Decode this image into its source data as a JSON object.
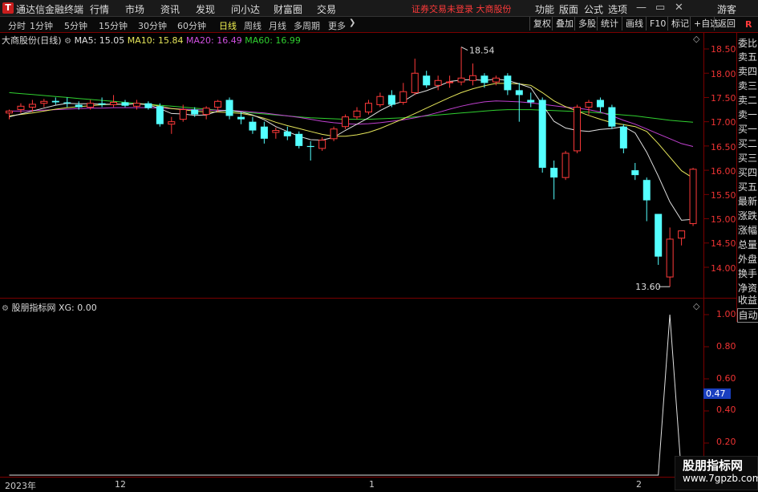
{
  "menubar": {
    "app_title": "通达信金融终端",
    "menus": [
      "行情",
      "市场",
      "资讯",
      "发现",
      "问小达",
      "财富圈",
      "交易"
    ],
    "notice": "证券交易未登录  大商股份",
    "tools": [
      "功能",
      "版面",
      "公式",
      "选项"
    ],
    "guest": "游客",
    "window_buttons": [
      "—",
      "▭",
      "✕"
    ]
  },
  "periods": {
    "items": [
      "分时",
      "1分钟",
      "5分钟",
      "15分钟",
      "30分钟",
      "60分钟",
      "日线",
      "周线",
      "月线",
      "多周期",
      "更多"
    ],
    "active": "日线"
  },
  "right_toolbar": [
    "复权",
    "叠加",
    "多股",
    "统计",
    "画线",
    "F10",
    "标记",
    "+自选",
    "返回"
  ],
  "main_info": {
    "stock": "大商股份(日线)",
    "ma5": "MA5: 15.05",
    "ma10": "MA10: 15.84",
    "ma20": "MA20: 16.49",
    "ma60": "MA60: 16.99"
  },
  "sub_info": {
    "name": "股朋指标网",
    "xg": "XG: 0.00"
  },
  "price_axis": [
    "18.50",
    "18.00",
    "17.50",
    "17.00",
    "16.50",
    "16.00",
    "15.50",
    "15.00",
    "14.50",
    "14.00"
  ],
  "sub_axis": [
    "1.00",
    "0.80",
    "0.60",
    "0.47",
    "0.40",
    "0.20"
  ],
  "sub_axis_current": "0.47",
  "annotations": {
    "high": "18.54",
    "low": "13.60"
  },
  "sidebar": {
    "items": [
      "委比",
      "卖五",
      "卖四",
      "卖三",
      "卖二",
      "卖一",
      "买一",
      "买二",
      "买三",
      "买四",
      "买五",
      "最新",
      "涨跌",
      "涨幅",
      "总量",
      "外盘",
      "换手",
      "净资",
      "收益"
    ],
    "auto": "自动",
    "top_mark": "R"
  },
  "date_axis": [
    "2023年",
    "12",
    "1",
    "2"
  ],
  "watermark": {
    "name": "股朋指标网",
    "url": "www.7gpzb.com"
  },
  "colors": {
    "up": "#ff3a3a",
    "down": "#54ffff",
    "ma5": "#e0e0e0",
    "ma10": "#e6e65a",
    "ma20": "#c040d0",
    "ma60": "#30d030",
    "frame": "#7a0000"
  },
  "chart_data": {
    "type": "candlestick",
    "ylim": [
      13.5,
      18.8
    ],
    "candles": [
      {
        "o": 17.18,
        "h": 17.25,
        "l": 17.05,
        "c": 17.22
      },
      {
        "o": 17.25,
        "h": 17.38,
        "l": 17.18,
        "c": 17.32
      },
      {
        "o": 17.3,
        "h": 17.45,
        "l": 17.2,
        "c": 17.36
      },
      {
        "o": 17.38,
        "h": 17.47,
        "l": 17.3,
        "c": 17.42
      },
      {
        "o": 17.43,
        "h": 17.5,
        "l": 17.35,
        "c": 17.4
      },
      {
        "o": 17.4,
        "h": 17.5,
        "l": 17.3,
        "c": 17.38
      },
      {
        "o": 17.35,
        "h": 17.42,
        "l": 17.25,
        "c": 17.3
      },
      {
        "o": 17.3,
        "h": 17.45,
        "l": 17.25,
        "c": 17.38
      },
      {
        "o": 17.38,
        "h": 17.5,
        "l": 17.3,
        "c": 17.35
      },
      {
        "o": 17.35,
        "h": 17.55,
        "l": 17.3,
        "c": 17.4
      },
      {
        "o": 17.4,
        "h": 17.45,
        "l": 17.3,
        "c": 17.33
      },
      {
        "o": 17.32,
        "h": 17.45,
        "l": 17.25,
        "c": 17.38
      },
      {
        "o": 17.38,
        "h": 17.42,
        "l": 17.25,
        "c": 17.28
      },
      {
        "o": 17.32,
        "h": 17.38,
        "l": 16.9,
        "c": 16.95
      },
      {
        "o": 16.95,
        "h": 17.1,
        "l": 16.75,
        "c": 17.0
      },
      {
        "o": 17.05,
        "h": 17.35,
        "l": 17.0,
        "c": 17.25
      },
      {
        "o": 17.25,
        "h": 17.3,
        "l": 17.1,
        "c": 17.15
      },
      {
        "o": 17.15,
        "h": 17.32,
        "l": 17.05,
        "c": 17.28
      },
      {
        "o": 17.3,
        "h": 17.45,
        "l": 17.2,
        "c": 17.42
      },
      {
        "o": 17.45,
        "h": 17.5,
        "l": 17.05,
        "c": 17.12
      },
      {
        "o": 17.1,
        "h": 17.2,
        "l": 16.95,
        "c": 17.05
      },
      {
        "o": 17.0,
        "h": 17.1,
        "l": 16.75,
        "c": 16.82
      },
      {
        "o": 16.9,
        "h": 17.0,
        "l": 16.55,
        "c": 16.65
      },
      {
        "o": 16.78,
        "h": 16.88,
        "l": 16.65,
        "c": 16.82
      },
      {
        "o": 16.8,
        "h": 16.9,
        "l": 16.62,
        "c": 16.7
      },
      {
        "o": 16.75,
        "h": 16.8,
        "l": 16.45,
        "c": 16.5
      },
      {
        "o": 16.5,
        "h": 16.6,
        "l": 16.2,
        "c": 16.48
      },
      {
        "o": 16.45,
        "h": 16.68,
        "l": 16.4,
        "c": 16.62
      },
      {
        "o": 16.65,
        "h": 16.9,
        "l": 16.6,
        "c": 16.85
      },
      {
        "o": 16.9,
        "h": 17.15,
        "l": 16.85,
        "c": 17.1
      },
      {
        "o": 17.1,
        "h": 17.3,
        "l": 17.05,
        "c": 17.22
      },
      {
        "o": 17.2,
        "h": 17.45,
        "l": 17.15,
        "c": 17.38
      },
      {
        "o": 17.35,
        "h": 17.6,
        "l": 17.3,
        "c": 17.52
      },
      {
        "o": 17.55,
        "h": 17.65,
        "l": 17.3,
        "c": 17.35
      },
      {
        "o": 17.4,
        "h": 17.8,
        "l": 17.35,
        "c": 17.62
      },
      {
        "o": 17.6,
        "h": 18.3,
        "l": 17.55,
        "c": 18.0
      },
      {
        "o": 17.95,
        "h": 18.05,
        "l": 17.7,
        "c": 17.75
      },
      {
        "o": 17.75,
        "h": 17.95,
        "l": 17.65,
        "c": 17.85
      },
      {
        "o": 17.82,
        "h": 17.95,
        "l": 17.7,
        "c": 17.82
      },
      {
        "o": 17.82,
        "h": 18.54,
        "l": 17.75,
        "c": 17.9
      },
      {
        "o": 17.85,
        "h": 18.2,
        "l": 17.75,
        "c": 17.95
      },
      {
        "o": 17.95,
        "h": 18.0,
        "l": 17.7,
        "c": 17.8
      },
      {
        "o": 17.82,
        "h": 17.95,
        "l": 17.75,
        "c": 17.9
      },
      {
        "o": 17.95,
        "h": 18.0,
        "l": 17.55,
        "c": 17.65
      },
      {
        "o": 17.65,
        "h": 17.8,
        "l": 17.0,
        "c": 17.55
      },
      {
        "o": 17.45,
        "h": 17.6,
        "l": 17.3,
        "c": 17.4
      },
      {
        "o": 17.45,
        "h": 17.5,
        "l": 15.95,
        "c": 16.05
      },
      {
        "o": 16.05,
        "h": 16.2,
        "l": 15.4,
        "c": 15.85
      },
      {
        "o": 15.85,
        "h": 16.4,
        "l": 15.8,
        "c": 16.35
      },
      {
        "o": 16.4,
        "h": 17.35,
        "l": 16.35,
        "c": 17.3
      },
      {
        "o": 17.3,
        "h": 17.45,
        "l": 17.15,
        "c": 17.4
      },
      {
        "o": 17.45,
        "h": 17.5,
        "l": 17.2,
        "c": 17.3
      },
      {
        "o": 17.3,
        "h": 17.35,
        "l": 16.85,
        "c": 16.9
      },
      {
        "o": 16.9,
        "h": 16.95,
        "l": 16.35,
        "c": 16.45
      },
      {
        "o": 16.0,
        "h": 16.15,
        "l": 15.8,
        "c": 15.9
      },
      {
        "o": 15.8,
        "h": 15.85,
        "l": 14.95,
        "c": 15.38
      },
      {
        "o": 15.1,
        "h": 15.1,
        "l": 14.05,
        "c": 14.22
      },
      {
        "o": 13.8,
        "h": 14.82,
        "l": 13.6,
        "c": 14.58
      },
      {
        "o": 14.6,
        "h": 14.75,
        "l": 14.45,
        "c": 14.75
      },
      {
        "o": 14.9,
        "h": 16.05,
        "l": 14.85,
        "c": 16.02
      }
    ],
    "ma5": [
      17.1,
      17.16,
      17.22,
      17.28,
      17.34,
      17.38,
      17.37,
      17.37,
      17.36,
      17.36,
      17.36,
      17.37,
      17.35,
      17.27,
      17.17,
      17.16,
      17.13,
      17.14,
      17.22,
      17.24,
      17.2,
      17.14,
      17.04,
      16.9,
      16.8,
      16.7,
      16.63,
      16.62,
      16.68,
      16.82,
      16.95,
      17.08,
      17.23,
      17.35,
      17.42,
      17.57,
      17.64,
      17.73,
      17.83,
      17.86,
      17.87,
      17.85,
      17.88,
      17.85,
      17.78,
      17.7,
      17.35,
      17.01,
      16.87,
      16.82,
      16.8,
      16.84,
      16.86,
      16.9,
      16.77,
      16.37,
      15.88,
      15.35,
      14.97,
      14.99
    ],
    "ma10": [
      17.12,
      17.15,
      17.18,
      17.22,
      17.26,
      17.29,
      17.31,
      17.33,
      17.35,
      17.36,
      17.36,
      17.37,
      17.36,
      17.32,
      17.27,
      17.25,
      17.22,
      17.2,
      17.2,
      17.19,
      17.17,
      17.13,
      17.07,
      16.99,
      16.92,
      16.86,
      16.8,
      16.74,
      16.7,
      16.7,
      16.73,
      16.78,
      16.86,
      16.96,
      17.06,
      17.17,
      17.28,
      17.39,
      17.5,
      17.6,
      17.68,
      17.74,
      17.79,
      17.79,
      17.78,
      17.75,
      17.6,
      17.43,
      17.31,
      17.22,
      17.13,
      17.05,
      16.98,
      16.94,
      16.9,
      16.8,
      16.55,
      16.27,
      15.99,
      15.84
    ],
    "ma20": [
      17.22,
      17.22,
      17.23,
      17.24,
      17.25,
      17.26,
      17.27,
      17.28,
      17.28,
      17.29,
      17.29,
      17.29,
      17.29,
      17.28,
      17.27,
      17.26,
      17.25,
      17.24,
      17.24,
      17.23,
      17.22,
      17.2,
      17.18,
      17.15,
      17.12,
      17.09,
      17.05,
      17.01,
      16.98,
      16.96,
      16.95,
      16.96,
      16.98,
      17.01,
      17.04,
      17.08,
      17.13,
      17.19,
      17.26,
      17.32,
      17.37,
      17.41,
      17.43,
      17.42,
      17.41,
      17.39,
      17.36,
      17.33,
      17.3,
      17.28,
      17.25,
      17.2,
      17.12,
      17.03,
      16.95,
      16.85,
      16.75,
      16.65,
      16.55,
      16.49
    ],
    "ma60": [
      17.6,
      17.58,
      17.56,
      17.54,
      17.52,
      17.5,
      17.48,
      17.46,
      17.44,
      17.42,
      17.4,
      17.38,
      17.36,
      17.34,
      17.32,
      17.3,
      17.28,
      17.26,
      17.24,
      17.22,
      17.2,
      17.18,
      17.16,
      17.14,
      17.12,
      17.1,
      17.08,
      17.07,
      17.06,
      17.05,
      17.05,
      17.05,
      17.06,
      17.07,
      17.08,
      17.1,
      17.12,
      17.14,
      17.16,
      17.18,
      17.2,
      17.22,
      17.24,
      17.25,
      17.25,
      17.25,
      17.24,
      17.23,
      17.22,
      17.21,
      17.2,
      17.18,
      17.16,
      17.14,
      17.12,
      17.09,
      17.06,
      17.03,
      17.01,
      16.99
    ],
    "xg": [
      0,
      0,
      0,
      0,
      0,
      0,
      0,
      0,
      0,
      0,
      0,
      0,
      0,
      0,
      0,
      0,
      0,
      0,
      0,
      0,
      0,
      0,
      0,
      0,
      0,
      0,
      0,
      0,
      0,
      0,
      0,
      0,
      0,
      0,
      0,
      0,
      0,
      0,
      0,
      0,
      0,
      0,
      0,
      0,
      0,
      0,
      0,
      0,
      0,
      0,
      0,
      0,
      0,
      0,
      0,
      0,
      0,
      1,
      0,
      0
    ],
    "xg_ylim": [
      0,
      1.08
    ]
  }
}
